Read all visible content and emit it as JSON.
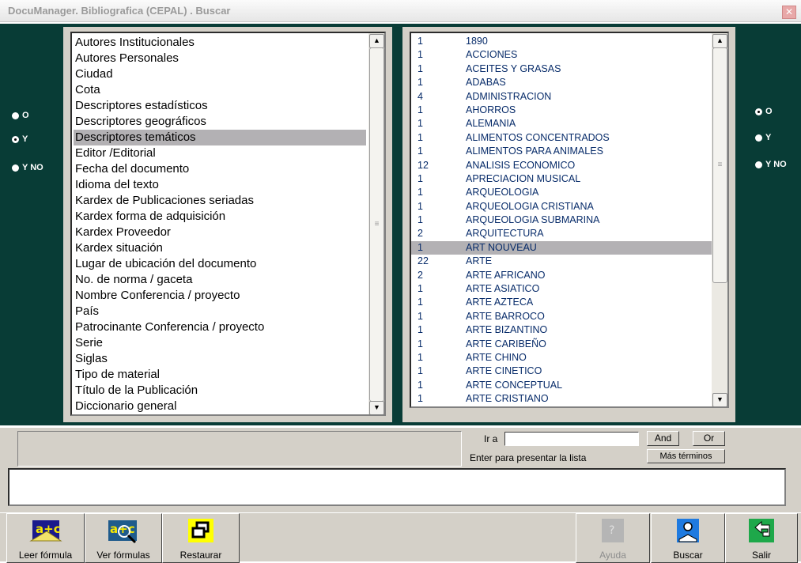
{
  "window": {
    "title": "DocuManager. Bibliografica (CEPAL) . Buscar",
    "close_glyph": "✕"
  },
  "left_radios": [
    {
      "label": "O",
      "checked": false
    },
    {
      "label": "Y",
      "checked": true
    },
    {
      "label": "Y NO",
      "checked": false
    }
  ],
  "right_radios": [
    {
      "label": "O",
      "checked": true
    },
    {
      "label": "Y",
      "checked": false
    },
    {
      "label": "Y NO",
      "checked": false
    }
  ],
  "fields": [
    "Autores Institucionales",
    "Autores Personales",
    "Ciudad",
    "Cota",
    "Descriptores estadísticos",
    "Descriptores geográficos",
    "Descriptores temáticos",
    "Editor /Editorial",
    "Fecha del documento",
    "Idioma del texto",
    "Kardex de Publicaciones seriadas",
    "Kardex forma de adquisición",
    "Kardex Proveedor",
    "Kardex situación",
    "Lugar de ubicación del documento",
    "No. de norma / gaceta",
    "Nombre Conferencia / proyecto",
    "País",
    "Patrocinante Conferencia / proyecto",
    "Serie",
    "Siglas",
    "Tipo de material",
    "Título de la Publicación",
    "Diccionario general"
  ],
  "selected_field_index": 6,
  "terms": [
    {
      "count": "1",
      "term": "1890"
    },
    {
      "count": "1",
      "term": "ACCIONES"
    },
    {
      "count": "1",
      "term": "ACEITES Y GRASAS"
    },
    {
      "count": "1",
      "term": "ADABAS"
    },
    {
      "count": "4",
      "term": "ADMINISTRACION"
    },
    {
      "count": "1",
      "term": "AHORROS"
    },
    {
      "count": "1",
      "term": "ALEMANIA"
    },
    {
      "count": "1",
      "term": "ALIMENTOS CONCENTRADOS"
    },
    {
      "count": "1",
      "term": "ALIMENTOS PARA ANIMALES"
    },
    {
      "count": "12",
      "term": "ANALISIS ECONOMICO"
    },
    {
      "count": "1",
      "term": "APRECIACION MUSICAL"
    },
    {
      "count": "1",
      "term": "ARQUEOLOGIA"
    },
    {
      "count": "1",
      "term": "ARQUEOLOGIA CRISTIANA"
    },
    {
      "count": "1",
      "term": "ARQUEOLOGIA SUBMARINA"
    },
    {
      "count": "2",
      "term": "ARQUITECTURA"
    },
    {
      "count": "1",
      "term": "ART NOUVEAU"
    },
    {
      "count": "22",
      "term": "ARTE"
    },
    {
      "count": "2",
      "term": "ARTE AFRICANO"
    },
    {
      "count": "1",
      "term": "ARTE ASIATICO"
    },
    {
      "count": "1",
      "term": "ARTE AZTECA"
    },
    {
      "count": "1",
      "term": "ARTE BARROCO"
    },
    {
      "count": "1",
      "term": "ARTE BIZANTINO"
    },
    {
      "count": "1",
      "term": "ARTE CARIBEÑO"
    },
    {
      "count": "1",
      "term": "ARTE CHINO"
    },
    {
      "count": "1",
      "term": "ARTE CINETICO"
    },
    {
      "count": "1",
      "term": "ARTE CONCEPTUAL"
    },
    {
      "count": "1",
      "term": "ARTE CRISTIANO"
    }
  ],
  "selected_term_index": 15,
  "search": {
    "goto_label": "Ir a",
    "goto_value": "",
    "hint": "Enter para presentar la lista",
    "and_label": "And",
    "or_label": "Or",
    "more_label": "Más términos"
  },
  "formula_text": "",
  "toolbar": {
    "leer": "Leer fórmula",
    "ver": "Ver fórmulas",
    "restaurar": "Restaurar",
    "ayuda": "Ayuda",
    "buscar": "Buscar",
    "salir": "Salir"
  },
  "colors": {
    "panel_bg": "#083c36",
    "term_text": "#082c6a",
    "selection": "#b3b1b4"
  }
}
